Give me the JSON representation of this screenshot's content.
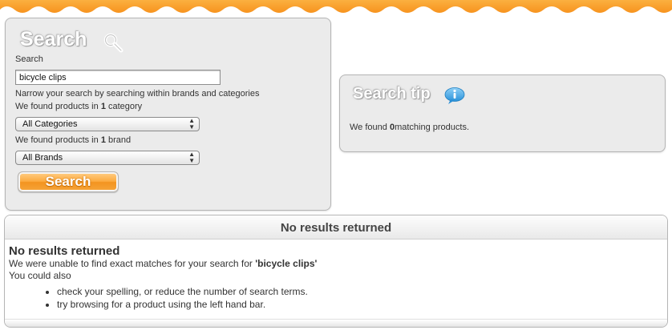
{
  "colors": {
    "accent": "#f7931e",
    "panel_bg": "#ebebeb"
  },
  "search_panel": {
    "title": "Search",
    "title_icon": "magnifier-icon",
    "field_label": "Search",
    "query_value": "bicycle clips",
    "narrow_text": "Narrow your search by searching within brands and categories",
    "category_count_prefix": "We found products in ",
    "category_count": "1",
    "category_count_suffix": " category",
    "category_select": "All Categories",
    "brand_count_prefix": "We found products in ",
    "brand_count": "1",
    "brand_count_suffix": " brand",
    "brand_select": "All Brands",
    "button_label": "Search"
  },
  "tip_panel": {
    "title": "Search tip",
    "title_icon": "info-bubble-icon",
    "text_prefix": "We found ",
    "count": "0",
    "text_suffix": "matching products."
  },
  "results": {
    "header": "No results returned",
    "title": "No results returned",
    "message_prefix": "We were unable to find exact matches for your search for ",
    "message_query": "'bicycle clips'",
    "could_also": "You could also",
    "suggestions": [
      "check your spelling, or reduce the number of search terms.",
      "try browsing for a product using the left hand bar."
    ]
  }
}
